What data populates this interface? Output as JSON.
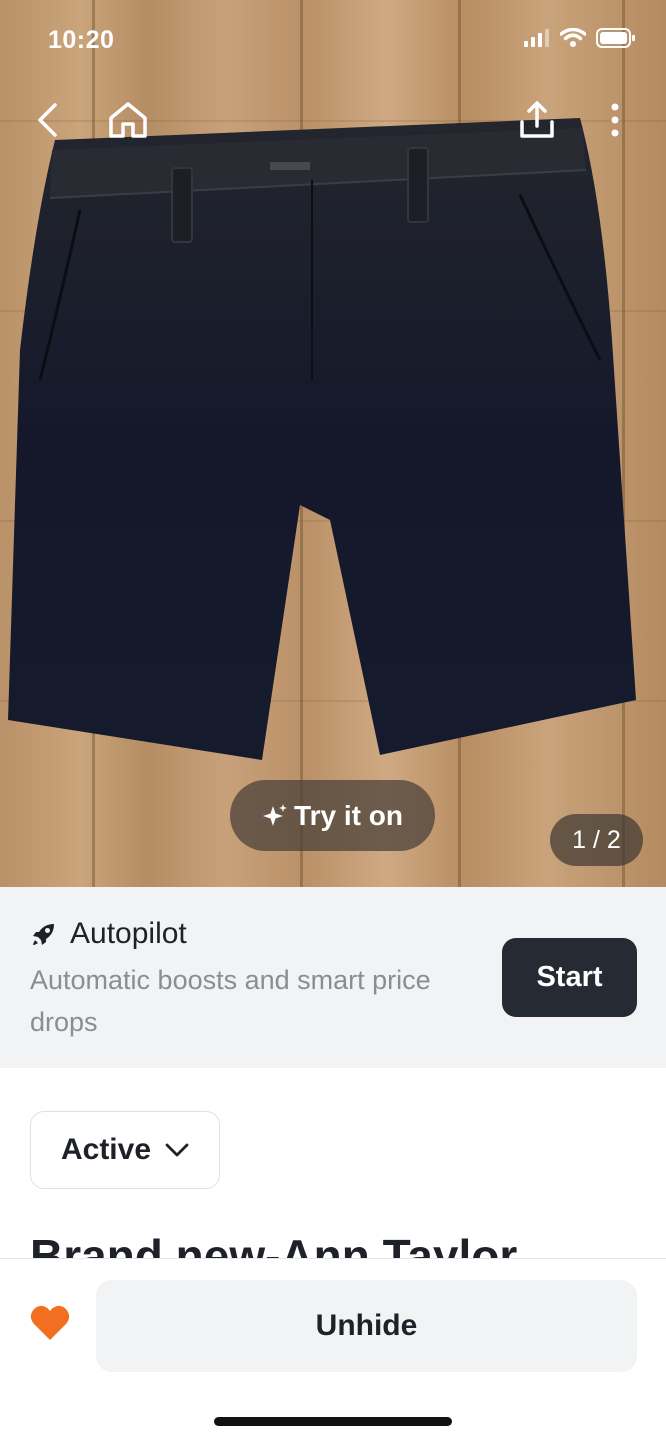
{
  "status_bar": {
    "time": "10:20"
  },
  "top_nav": {
    "back_icon": "chevron-left-icon",
    "home_icon": "home-icon",
    "share_icon": "share-icon",
    "more_icon": "more-vertical-icon"
  },
  "gallery": {
    "try_on_label": "Try it on",
    "try_on_icon": "sparkle-icon",
    "counter": "1 / 2"
  },
  "autopilot": {
    "icon": "rocket-icon",
    "title": "Autopilot",
    "description": "Automatic boosts and smart price drops",
    "start_label": "Start"
  },
  "listing": {
    "status": "Active",
    "title_partial": "Brand new-Ann Taylor"
  },
  "bottom_bar": {
    "unhide_label": "Unhide",
    "heart_color": "#f26f21"
  },
  "colors": {
    "accent_dark": "#252a33",
    "panel_gray": "#f2f3f5",
    "muted_text": "#8a8d93"
  }
}
